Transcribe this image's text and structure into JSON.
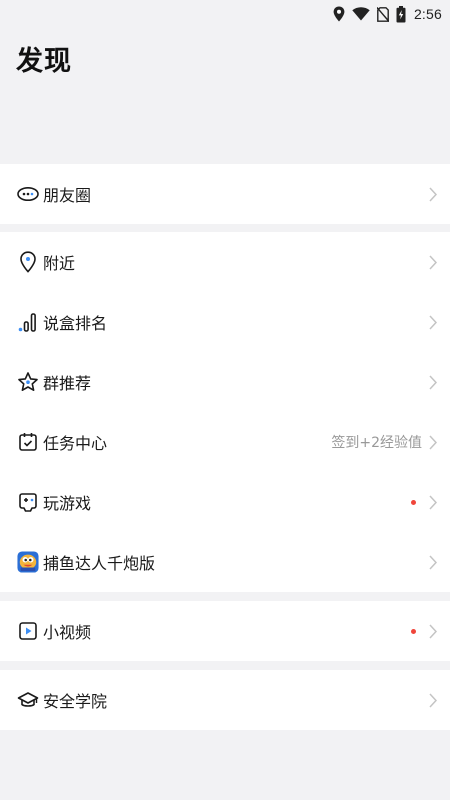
{
  "status_bar": {
    "time": "2:56",
    "icons": [
      "location-icon",
      "wifi-icon",
      "no-sim-icon",
      "battery-charging-icon"
    ]
  },
  "header": {
    "title": "发现"
  },
  "colors": {
    "background": "#f2f2f4",
    "card": "#ffffff",
    "text": "#1a1a1a",
    "secondary_text": "#999999",
    "chevron": "#c4c4c4",
    "accent_blue": "#3d8ff5",
    "badge_red": "#f0453a"
  },
  "sections": [
    {
      "items": [
        {
          "icon": "moments-icon",
          "label": "朋友圈"
        }
      ]
    },
    {
      "items": [
        {
          "icon": "location-pin-icon",
          "label": "附近"
        },
        {
          "icon": "ranking-icon",
          "label": "说盒排名"
        },
        {
          "icon": "star-icon",
          "label": "群推荐"
        },
        {
          "icon": "calendar-task-icon",
          "label": "任务中心",
          "sub": "签到+2经验值"
        },
        {
          "icon": "gamepad-icon",
          "label": "玩游戏",
          "badge": "dot"
        },
        {
          "icon": "fishing-game-icon",
          "label": "捕鱼达人千炮版"
        }
      ]
    },
    {
      "items": [
        {
          "icon": "video-play-icon",
          "label": "小视频",
          "badge": "dot"
        }
      ]
    },
    {
      "items": [
        {
          "icon": "graduation-cap-icon",
          "label": "安全学院"
        }
      ]
    }
  ]
}
